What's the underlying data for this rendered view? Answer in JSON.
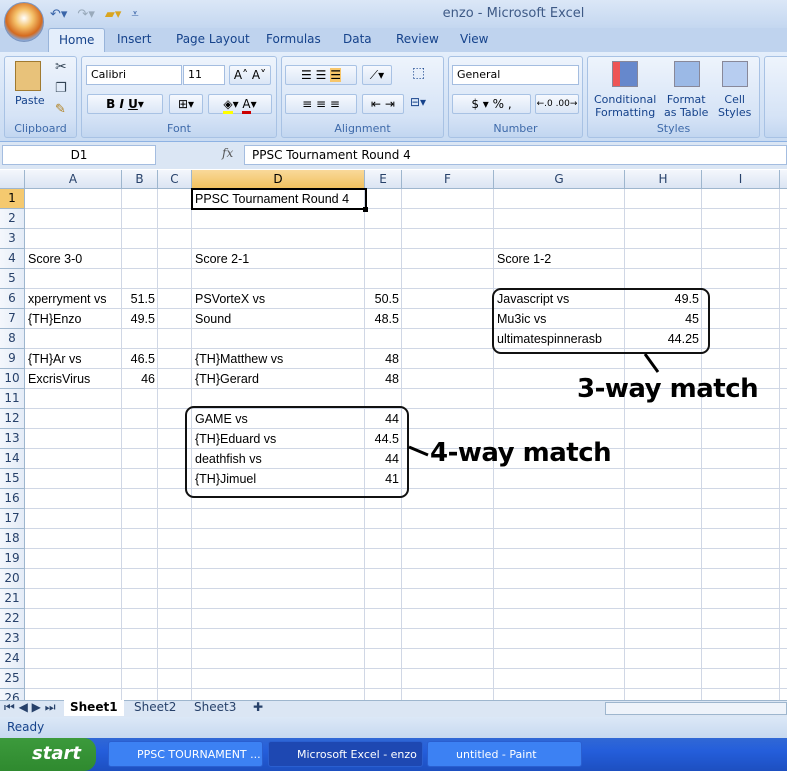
{
  "window": {
    "title": "enzo  -  Microsoft Excel"
  },
  "ribbon": {
    "tabs": [
      "Home",
      "Insert",
      "Page Layout",
      "Formulas",
      "Data",
      "Review",
      "View"
    ],
    "active_tab": "Home",
    "groups": {
      "clipboard": "Clipboard",
      "font": "Font",
      "alignment": "Alignment",
      "number": "Number",
      "styles": "Styles"
    },
    "paste_label": "Paste",
    "font_name": "Calibri",
    "font_size": "11",
    "number_format": "General",
    "conditional_formatting": [
      "Conditional",
      "Formatting"
    ],
    "format_as_table": [
      "Format",
      "as Table"
    ],
    "cell_styles": [
      "Cell",
      "Styles"
    ]
  },
  "formula_bar": {
    "name_box": "D1",
    "fx": "fx",
    "value": "PPSC Tournament Round 4"
  },
  "sheet": {
    "columns": [
      "A",
      "B",
      "C",
      "D",
      "E",
      "F",
      "G",
      "H",
      "I"
    ],
    "selected_column": "D",
    "selected_row": 1,
    "row_count": 26,
    "cells": [
      {
        "ref": "D1",
        "value": "PPSC Tournament Round 4"
      },
      {
        "ref": "A4",
        "value": "Score 3-0"
      },
      {
        "ref": "D4",
        "value": "Score 2-1"
      },
      {
        "ref": "G4",
        "value": "Score 1-2"
      },
      {
        "ref": "A6",
        "value": "xperryment vs"
      },
      {
        "ref": "B6",
        "value": "51.5"
      },
      {
        "ref": "D6",
        "value": "PSVorteX vs"
      },
      {
        "ref": "E6",
        "value": "50.5"
      },
      {
        "ref": "G6",
        "value": "Javascript vs"
      },
      {
        "ref": "H6",
        "value": "49.5"
      },
      {
        "ref": "A7",
        "value": "{TH}Enzo"
      },
      {
        "ref": "B7",
        "value": "49.5"
      },
      {
        "ref": "D7",
        "value": "Sound"
      },
      {
        "ref": "E7",
        "value": "48.5"
      },
      {
        "ref": "G7",
        "value": "Mu3ic vs"
      },
      {
        "ref": "H7",
        "value": "45"
      },
      {
        "ref": "G8",
        "value": "ultimatespinnerasb"
      },
      {
        "ref": "H8",
        "value": "44.25"
      },
      {
        "ref": "A9",
        "value": "{TH}Ar vs"
      },
      {
        "ref": "B9",
        "value": "46.5"
      },
      {
        "ref": "D9",
        "value": "{TH}Matthew vs"
      },
      {
        "ref": "E9",
        "value": "48"
      },
      {
        "ref": "A10",
        "value": "ExcrisVirus"
      },
      {
        "ref": "B10",
        "value": "46"
      },
      {
        "ref": "D10",
        "value": "{TH}Gerard"
      },
      {
        "ref": "E10",
        "value": "48"
      },
      {
        "ref": "D12",
        "value": "GAME vs"
      },
      {
        "ref": "E12",
        "value": "44"
      },
      {
        "ref": "D13",
        "value": "{TH}Eduard vs"
      },
      {
        "ref": "E13",
        "value": "44.5"
      },
      {
        "ref": "D14",
        "value": "deathfish vs"
      },
      {
        "ref": "E14",
        "value": "44"
      },
      {
        "ref": "D15",
        "value": "{TH}Jimuel"
      },
      {
        "ref": "E15",
        "value": "41"
      }
    ]
  },
  "annotations": {
    "three_way": "3-way match",
    "four_way": "4-way match"
  },
  "sheet_tabs": [
    "Sheet1",
    "Sheet2",
    "Sheet3"
  ],
  "active_sheet": "Sheet1",
  "status": "Ready",
  "taskbar": {
    "start": "start",
    "items": [
      "PPSC TOURNAMENT ...",
      "Microsoft Excel - enzo",
      "untitled - Paint"
    ],
    "active_item": "Microsoft Excel - enzo"
  }
}
